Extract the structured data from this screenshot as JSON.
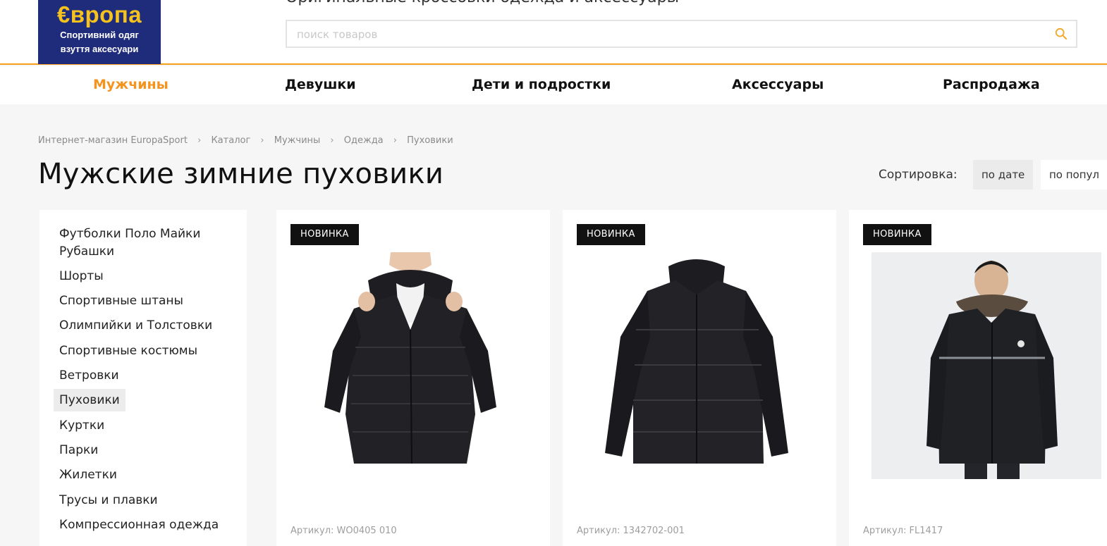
{
  "header": {
    "logo": {
      "title": "€вропа",
      "line1": "Спортивний одяг",
      "line2": "взуття аксесуари"
    },
    "tagline": "Оригинальные кроссовки одежда и аксессуары",
    "search": {
      "placeholder": "поиск товаров",
      "value": "",
      "icon": "search-icon"
    }
  },
  "nav": {
    "items": [
      {
        "label": "Мужчины",
        "active": true
      },
      {
        "label": "Девушки"
      },
      {
        "label": "Дети и подростки"
      },
      {
        "label": "Аксессуары"
      },
      {
        "label": "Распродажа"
      }
    ]
  },
  "breadcrumb": [
    "Интернет-магазин EuropaSport",
    "Каталог",
    "Мужчины",
    "Одежда",
    "Пуховики"
  ],
  "breadcrumb_separator": "›",
  "page": {
    "title": "Мужские зимние пуховики"
  },
  "sort": {
    "label": "Сортировка:",
    "options": [
      "по дате",
      "по попул"
    ],
    "selected": "по дате"
  },
  "sidebar": {
    "items": [
      {
        "label": "Футболки Поло Майки Рубашки"
      },
      {
        "label": "Шорты"
      },
      {
        "label": "Спортивные штаны"
      },
      {
        "label": "Олимпийки и Толстовки"
      },
      {
        "label": "Спортивные костюмы"
      },
      {
        "label": "Ветровки"
      },
      {
        "label": "Пуховики",
        "active": true
      },
      {
        "label": "Куртки"
      },
      {
        "label": "Парки"
      },
      {
        "label": "Жилетки"
      },
      {
        "label": "Трусы и плавки"
      },
      {
        "label": "Компрессионная одежда"
      }
    ]
  },
  "products": [
    {
      "badge": "НОВИНКА",
      "sku": "Артикул: WO0405 010",
      "image": "jacket-hooded-model"
    },
    {
      "badge": "НОВИНКА",
      "sku": "Артикул: 1342702-001",
      "image": "jacket-collar"
    },
    {
      "badge": "НОВИНКА",
      "sku": "Артикул: FL1417",
      "image": "parka-fur-hood-model"
    }
  ],
  "colors": {
    "accent": "#f5931f",
    "logo_bg": "#1f2b7b",
    "logo_text": "#f6c21d",
    "badge_bg": "#111111"
  }
}
